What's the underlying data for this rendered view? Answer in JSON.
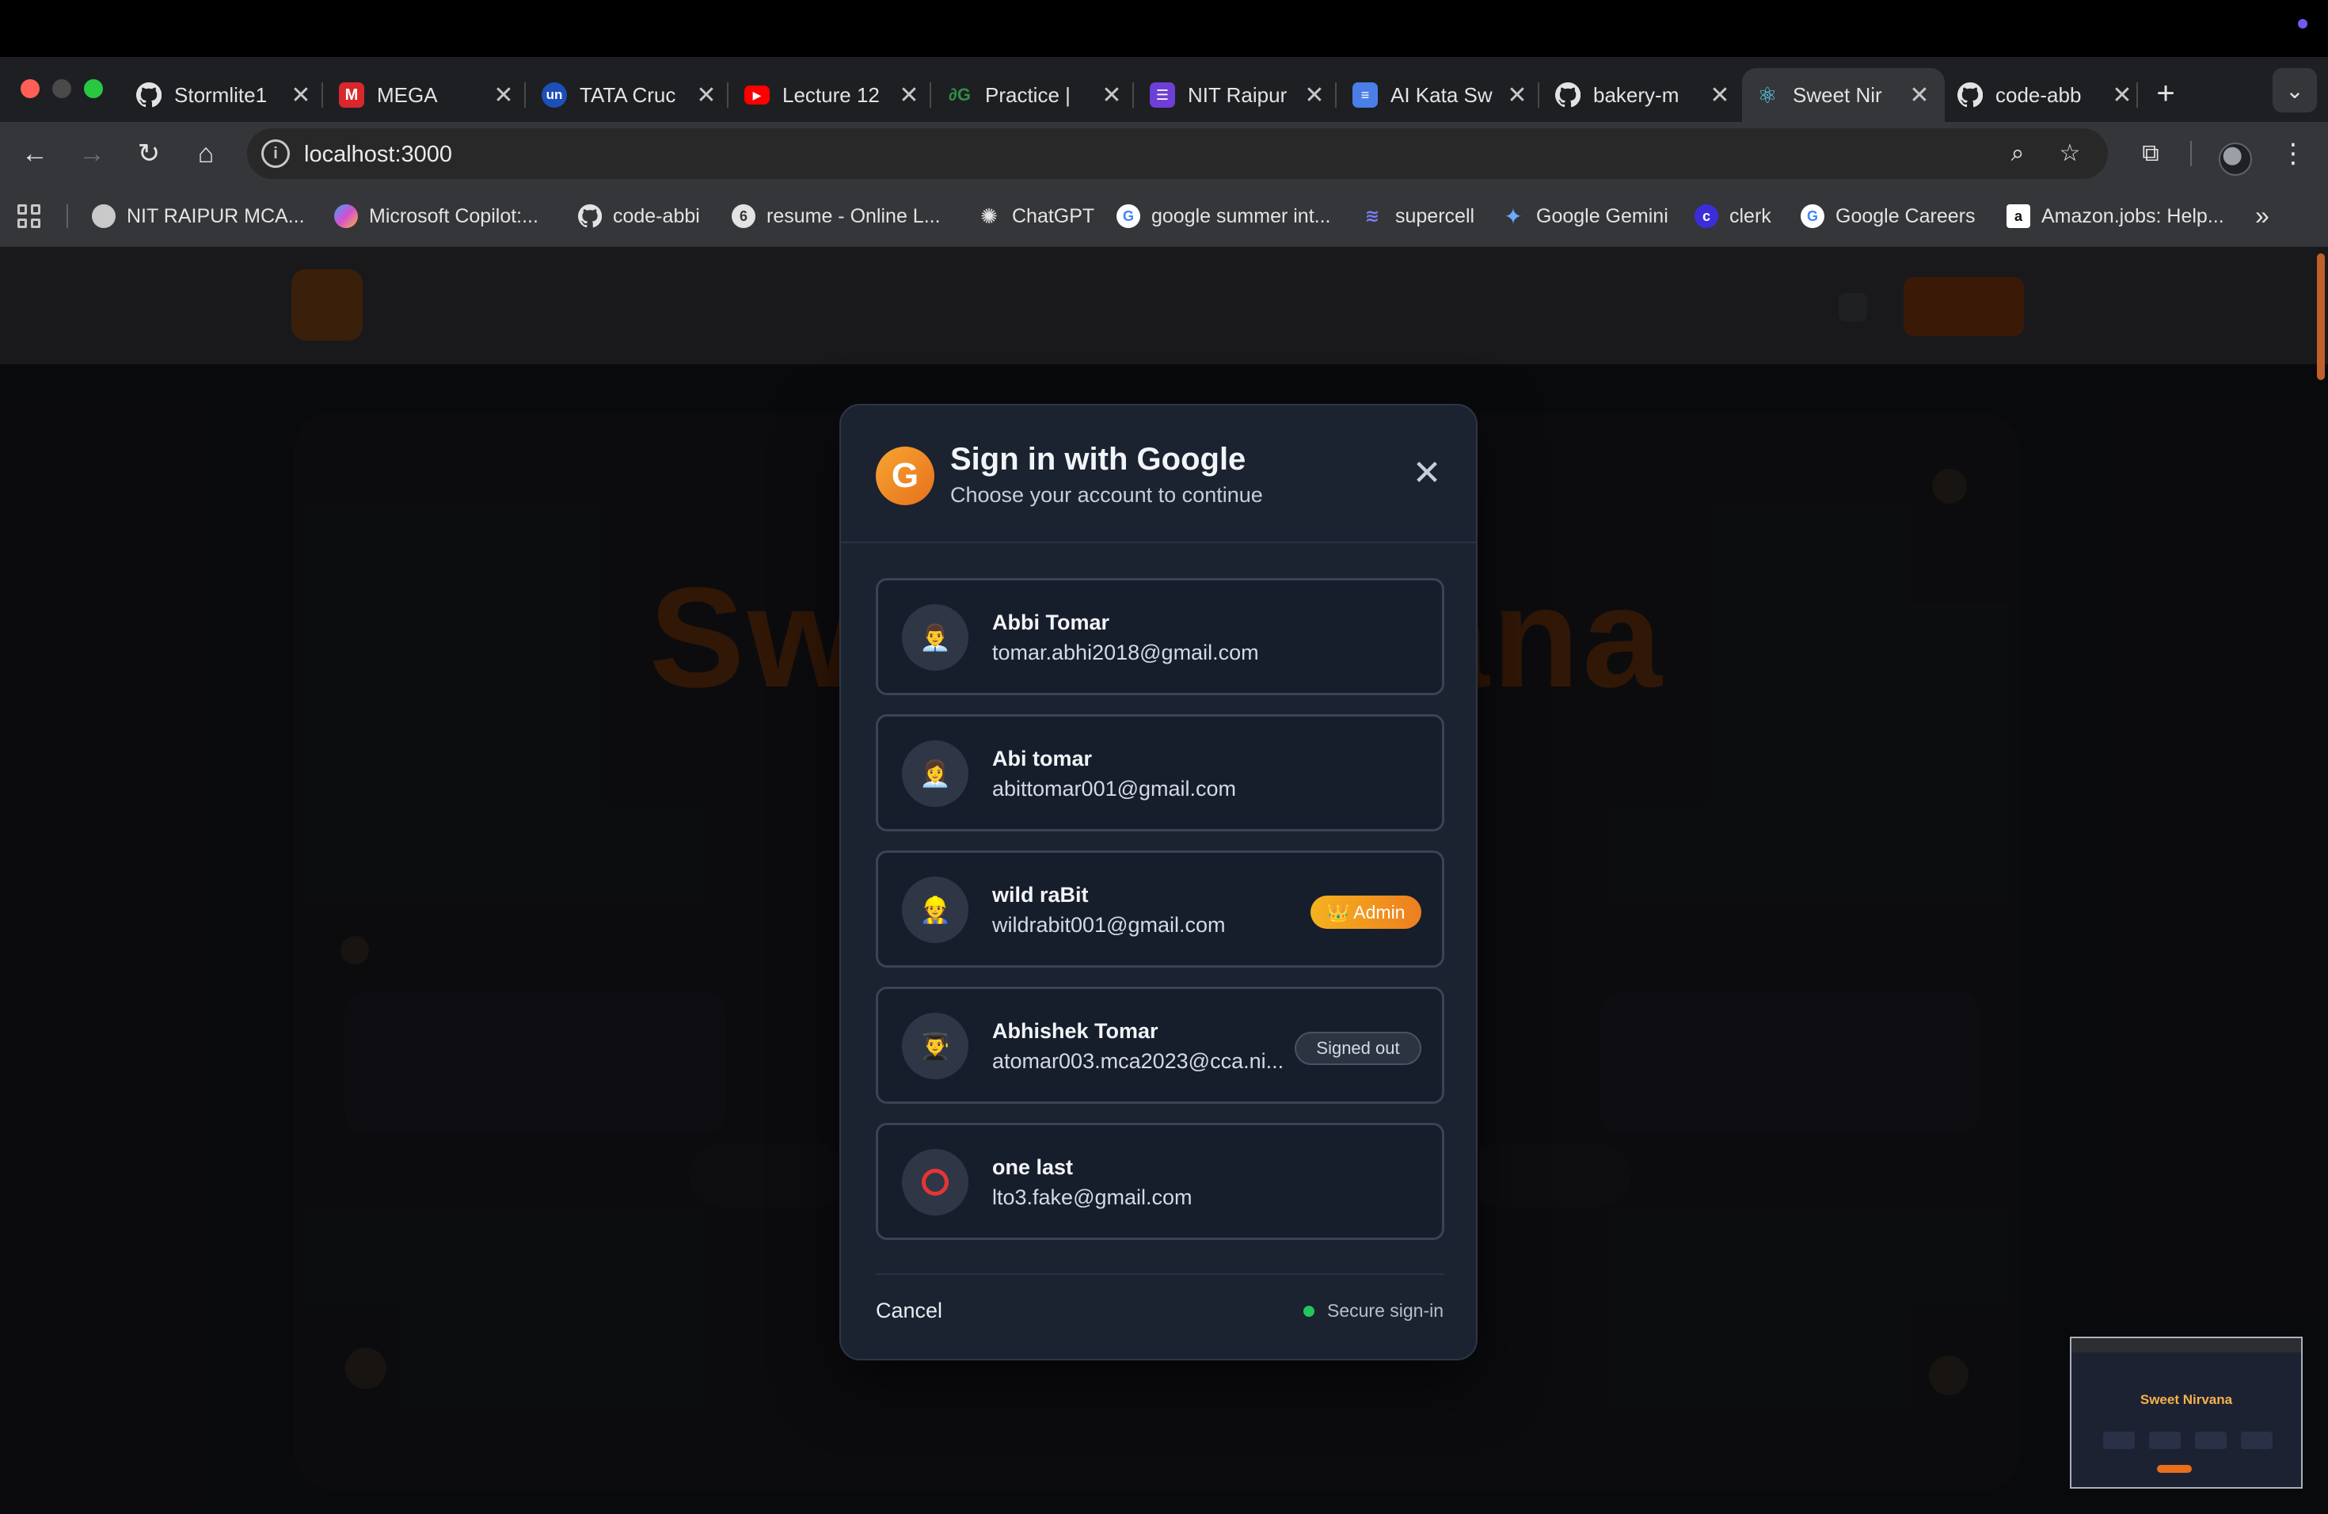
{
  "browser": {
    "tabs": [
      {
        "label": "Stormlite1",
        "icon": "github-icon"
      },
      {
        "label": "MEGA",
        "icon": "mega-icon"
      },
      {
        "label": "TATA Cruc",
        "icon": "unstop-icon"
      },
      {
        "label": "Lecture 12",
        "icon": "youtube-icon"
      },
      {
        "label": "Practice |",
        "icon": "gfg-icon"
      },
      {
        "label": "NIT Raipur",
        "icon": "form-icon"
      },
      {
        "label": "AI Kata Sw",
        "icon": "docs-icon"
      },
      {
        "label": "bakery-m",
        "icon": "github-icon"
      },
      {
        "label": "Sweet Nir",
        "icon": "react-icon"
      },
      {
        "label": "code-abb",
        "icon": "github-icon"
      }
    ],
    "tab_close_glyph": "✕",
    "new_tab_glyph": "+",
    "url": "localhost:3000",
    "bookmarks": [
      {
        "label": "NIT RAIPUR MCA...",
        "icon": "nit-icon"
      },
      {
        "label": "Microsoft Copilot:...",
        "icon": "copilot-icon"
      },
      {
        "label": "code-abbi",
        "icon": "github-icon"
      },
      {
        "label": "resume - Online L...",
        "icon": "overleaf-icon"
      },
      {
        "label": "ChatGPT",
        "icon": "chatgpt-icon"
      },
      {
        "label": "google summer int...",
        "icon": "google-icon"
      },
      {
        "label": "supercell",
        "icon": "supercell-icon"
      },
      {
        "label": "Google Gemini",
        "icon": "gemini-icon"
      },
      {
        "label": "clerk",
        "icon": "clerk-icon"
      },
      {
        "label": "Google Careers",
        "icon": "google-icon"
      },
      {
        "label": "Amazon.jobs: Help...",
        "icon": "amazon-icon"
      }
    ]
  },
  "background_page": {
    "hero_text": "Sweet Nirvana",
    "thumbnail_title": "Sweet Nirvana"
  },
  "modal": {
    "badge_letter": "G",
    "title": "Sign in with Google",
    "subtitle": "Choose your account to continue",
    "close_glyph": "✕",
    "accounts": [
      {
        "name": "Abbi Tomar",
        "email": "tomar.abhi2018@gmail.com",
        "avatar": "👨‍💼",
        "badge": ""
      },
      {
        "name": "Abi tomar",
        "email": "abittomar001@gmail.com",
        "avatar": "👩‍💼",
        "badge": ""
      },
      {
        "name": "wild raBit",
        "email": "wildrabit001@gmail.com",
        "avatar": "👷",
        "badge": "👑 Admin"
      },
      {
        "name": "Abhishek Tomar",
        "email": "atomar003.mca2023@cca.ni...",
        "avatar": "👨‍🎓",
        "badge": "Signed out"
      },
      {
        "name": "one last",
        "email": "lto3.fake@gmail.com",
        "avatar": "ring",
        "badge": ""
      }
    ],
    "cancel_label": "Cancel",
    "secure_label": "Secure sign-in"
  },
  "colors": {
    "accent": "#e8701c",
    "modal_bg": "#1b2230",
    "secure_dot": "#22c55e",
    "admin_badge": "#f5b21f"
  }
}
